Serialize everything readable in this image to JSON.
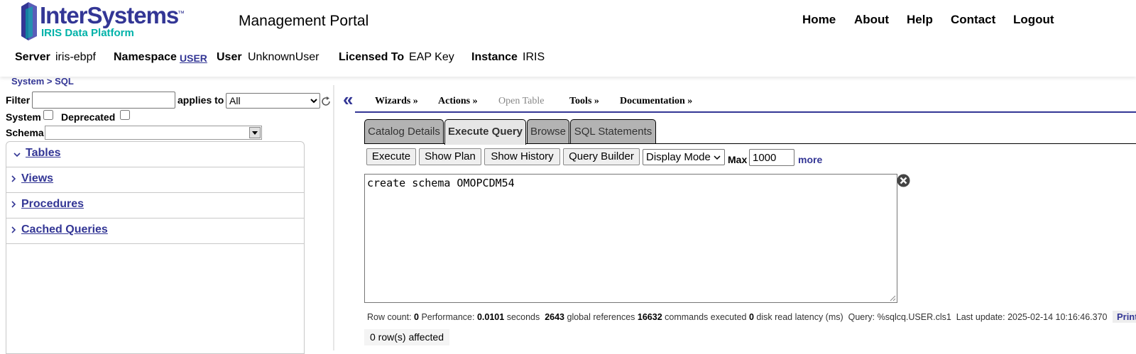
{
  "brand": {
    "name": "InterSystems",
    "tm": "™",
    "subtitle": "IRIS Data Platform",
    "portal_title": "Management Portal"
  },
  "nav": [
    "Home",
    "About",
    "Help",
    "Contact",
    "Logout"
  ],
  "info": {
    "server_label": "Server",
    "server_value": "iris-ebpf",
    "namespace_label": "Namespace",
    "namespace_value": "USER",
    "user_label": "User",
    "user_value": "UnknownUser",
    "licensed_label": "Licensed To",
    "licensed_value": "EAP Key",
    "instance_label": "Instance",
    "instance_value": "IRIS"
  },
  "breadcrumb": {
    "system": "System",
    "sep": ">",
    "sql": "SQL"
  },
  "left": {
    "filter_label": "Filter",
    "filter_value": "",
    "applies_label": "applies to",
    "applies_value": "All",
    "system_label": "System",
    "deprecated_label": "Deprecated",
    "schema_label": "Schema",
    "schema_value": "",
    "tree": [
      "Tables",
      "Views",
      "Procedures",
      "Cached Queries"
    ]
  },
  "toolbar": {
    "collapse_glyph": "«",
    "wizards": "Wizards »",
    "actions": "Actions »",
    "open_table": "Open Table",
    "tools": "Tools »",
    "documentation": "Documentation »"
  },
  "tabs": [
    "Catalog Details",
    "Execute Query",
    "Browse",
    "SQL Statements"
  ],
  "query": {
    "execute": "Execute",
    "show_plan": "Show Plan",
    "show_history": "Show History",
    "query_builder": "Query Builder",
    "display_mode": "Display Mode",
    "max_label": "Max",
    "max_value": "1000",
    "more": "more",
    "text": "create schema OMOPCDM54"
  },
  "stats": {
    "row_count_label": "Row count:",
    "row_count": "0",
    "performance_label": "Performance:",
    "performance": "0.0101",
    "seconds": "seconds",
    "global_refs": "2643",
    "global_refs_label": "global references",
    "commands": "16632",
    "commands_label": "commands executed",
    "latency": "0",
    "latency_label": "disk read latency (ms)",
    "query_label": "Query:",
    "query_name": "%sqlcq.USER.cls1",
    "last_update_label": "Last update:",
    "last_update": "2025-02-14 10:16:46.370",
    "print": "Print"
  },
  "result": "0 row(s) affected",
  "colors": {
    "brand": "#333695",
    "accent": "#00b2a9",
    "tab_active": "#e6e6e6",
    "tab": "#b3b3b3"
  }
}
